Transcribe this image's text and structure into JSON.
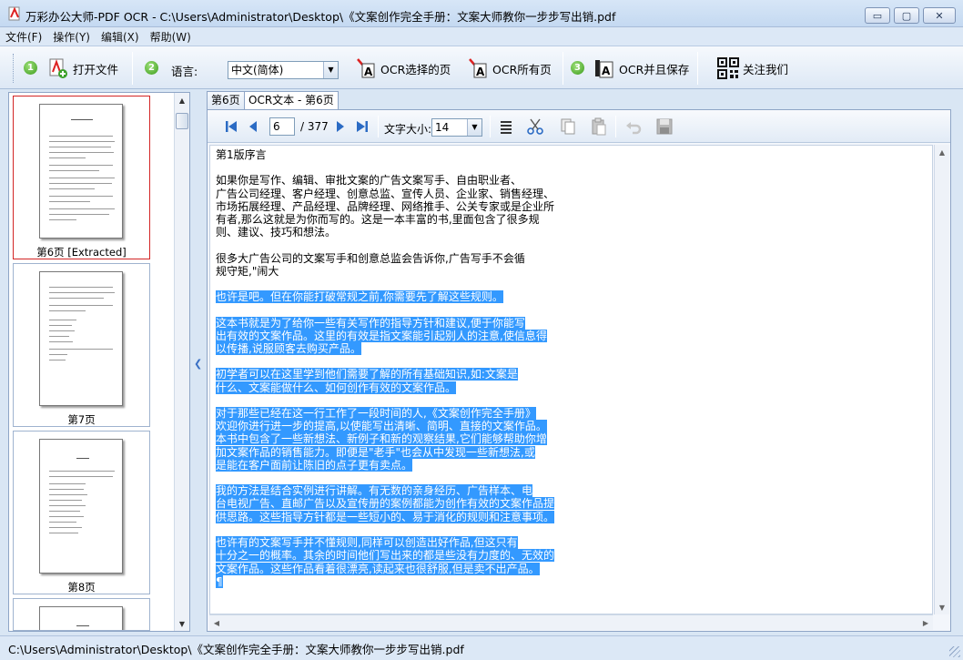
{
  "window": {
    "title": "万彩办公大师-PDF OCR - C:\\Users\\Administrator\\Desktop\\《文案创作完全手册：文案大师教你一步步写出销.pdf",
    "min_label": "▭",
    "max_label": "▢",
    "close_label": "✕"
  },
  "menu": {
    "file": "文件(F)",
    "actions": "操作(Y)",
    "edit": "编辑(X)",
    "help": "帮助(W)"
  },
  "toolbar": {
    "step1": "1",
    "open_file": "打开文件",
    "step2": "2",
    "language_label": "语言:",
    "language_value": "中文(简体)",
    "ocr_selected": "OCR选择的页",
    "ocr_all": "OCR所有页",
    "step3": "3",
    "ocr_save": "OCR并且保存",
    "follow_us": "关注我们"
  },
  "thumbnails": [
    {
      "caption": "第6页 [Extracted]",
      "selected": true
    },
    {
      "caption": "第7页",
      "selected": false
    },
    {
      "caption": "第8页",
      "selected": false
    },
    {
      "caption": "",
      "selected": false
    }
  ],
  "tabs": {
    "page_tab": "第6页",
    "ocr_tab": "OCR文本 - 第6页"
  },
  "ocr_toolbar": {
    "current_page": "6",
    "total_pages": "/  377",
    "font_size_label": "文字大小:",
    "font_size_value": "14"
  },
  "ocr_text": {
    "plain": "第1版序言\n\n如果你是写作、编辑、审批文案的广告文案写手、自由职业者、\n广告公司经理、客户经理、创意总监、宣传人员、企业家、销售经理、\n市场拓展经理、产品经理、品牌经理、网络推手、公关专家或是企业所\n有者,那么这就是为你而写的。这是一本丰富的书,里面包含了很多规\n则、建议、技巧和想法。\n\n很多大广告公司的文案写手和创意总监会告诉你,广告写手不会循\n规守矩,\"闹大\n\n",
    "highlighted": "也许是吧。但在你能打破常规之前,你需要先了解这些规则。\n\n这本书就是为了给你一些有关写作的指导方针和建议,便于你能写\n出有效的文案作品。这里的有效是指文案能引起别人的注意,使信息得\n以传播,说服顾客去购买产品。\n\n初学者可以在这里学到他们需要了解的所有基础知识,如:文案是\n什么、文案能做什么、如何创作有效的文案作品。\n\n对于那些已经在这一行工作了一段时间的人,《文案创作完全手册》\n欢迎你进行进一步的提高,以使能写出清晰、简明、直接的文案作品。\n本书中包含了一些新想法、新例子和新的观察结果,它们能够帮助你增\n加文案作品的销售能力。即便是\"老手\"也会从中发现一些新想法,或\n是能在客户面前让陈旧的点子更有卖点。\n\n我的方法是结合实例进行讲解。有无数的亲身经历、广告样本、电\n台电视广告、直邮广告以及宣传册的案例都能为创作有效的文案作品提\n供思路。这些指导方针都是一些短小的、易于消化的规则和注意事项。\n\n也许有的文案写手并不懂规则,同样可以创造出好作品,但这只有\n十分之一的概率。其余的时间他们写出来的都是些没有力度的、无效的\n文案作品。这些作品看着很漂亮,读起来也很舒服,但是卖不出产品。\n¶"
  },
  "status": {
    "path": "C:\\Users\\Administrator\\Desktop\\《文案创作完全手册：文案大师教你一步步写出销.pdf"
  }
}
